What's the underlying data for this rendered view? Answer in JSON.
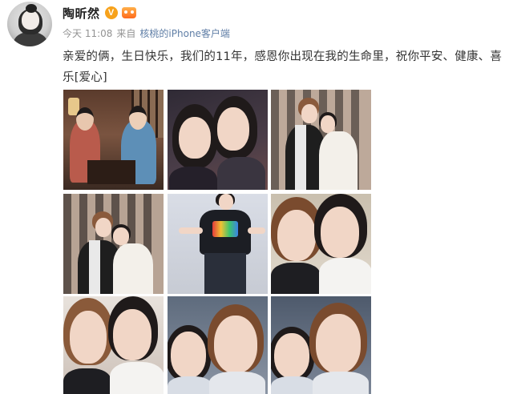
{
  "post": {
    "username": "陶昕然",
    "verified_badge": "V",
    "badges": [
      "verified-v-icon",
      "vip-crown-icon"
    ],
    "time": "今天 11:08",
    "source_prefix": "来自",
    "source": "核桃的iPhone客户端",
    "text": "亲爱的俩，生日快乐，我们的11年，感恩你出现在我的生命里，祝你平安、健康、喜乐[爱心]"
  },
  "photos": [
    {
      "name": "photo-period-drama"
    },
    {
      "name": "photo-selfie-dark"
    },
    {
      "name": "photo-hug-curtain-1"
    },
    {
      "name": "photo-hug-curtain-2"
    },
    {
      "name": "photo-tshirt-pose"
    },
    {
      "name": "photo-closeup-1"
    },
    {
      "name": "photo-closeup-2"
    },
    {
      "name": "photo-closeup-car-1"
    },
    {
      "name": "photo-closeup-car-2"
    }
  ],
  "colors": {
    "name": "#222222",
    "meta": "#939393",
    "source_link": "#5f7ea6",
    "badge_orange": "#f7a21b"
  }
}
